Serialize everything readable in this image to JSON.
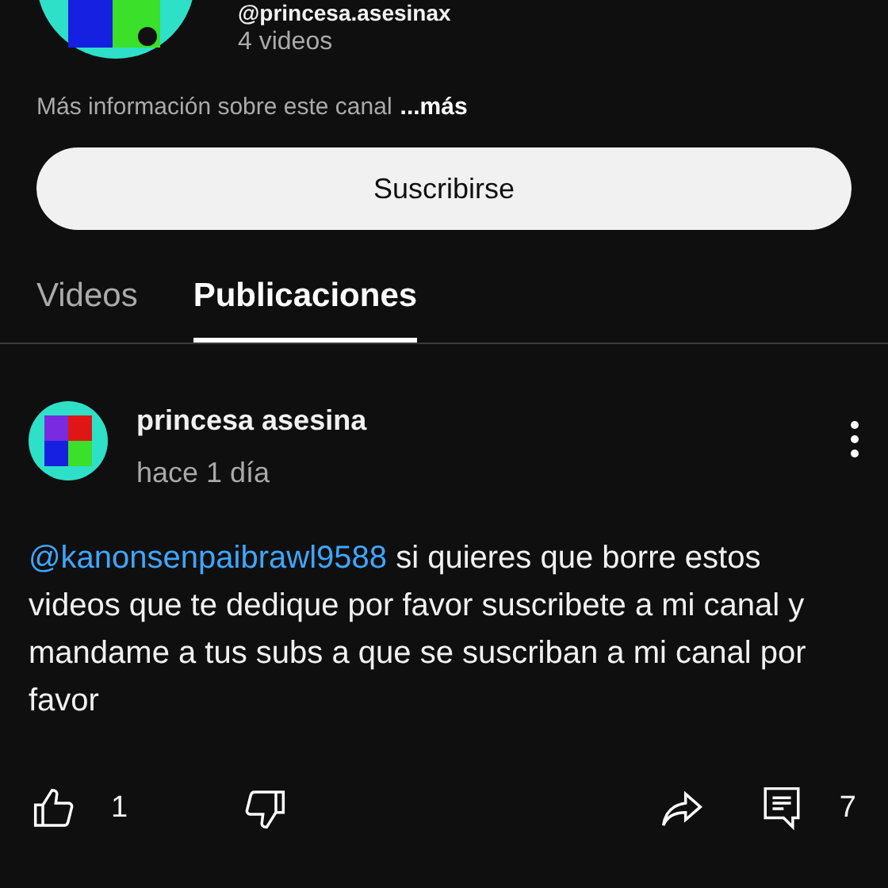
{
  "channel": {
    "handle": "@princesa.asesinax",
    "video_count": "4 videos",
    "about": "Más información sobre este canal",
    "more_link": "...más",
    "subscribe_label": "Suscribirse"
  },
  "tabs": [
    {
      "label": "Videos",
      "selected": false
    },
    {
      "label": "Publicaciones",
      "selected": true
    }
  ],
  "post": {
    "author": "princesa asesina",
    "time": "hace 1 día",
    "mention": "@kanonsenpaibrawl9588",
    "text": "si quieres que borre estos videos que te dedique por favor suscribete a mi canal y mandame a tus subs a que se suscriban a mi canal por favor",
    "likes": "1",
    "comments": "7"
  }
}
